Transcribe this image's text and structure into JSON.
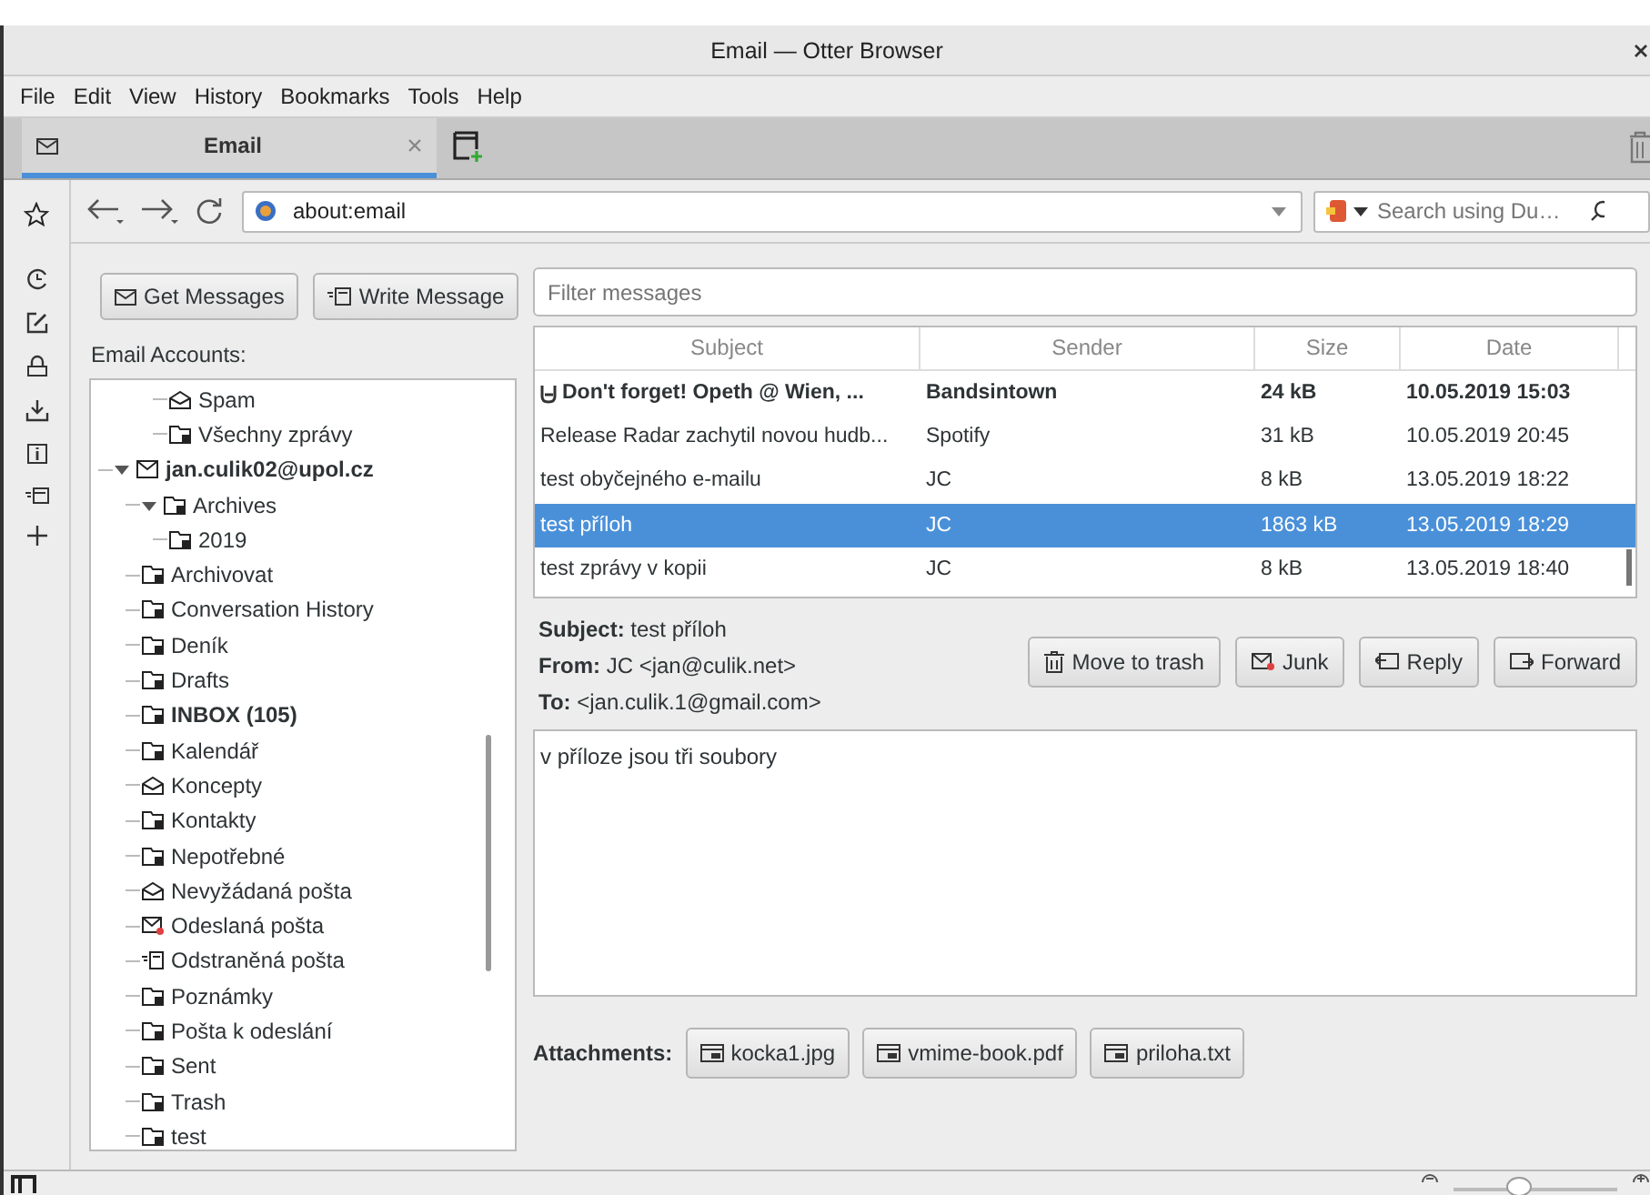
{
  "window": {
    "title": "Email — Otter Browser"
  },
  "menu": [
    "File",
    "Edit",
    "View",
    "History",
    "Bookmarks",
    "Tools",
    "Help"
  ],
  "tabs": [
    {
      "label": "Email",
      "selected": true
    }
  ],
  "address": {
    "value": "about:email"
  },
  "search": {
    "placeholder": "Search using Du…"
  },
  "toolbar": {
    "buttons": [
      "Get Messages",
      "Write Message"
    ]
  },
  "accounts_label": "Email Accounts:",
  "folders": [
    {
      "children": [
        {
          "children": [
            {
              "label": "Spam",
              "kind": "junk",
              "unread": false
            },
            {
              "label": "Všechny zprávy",
              "kind": "folder",
              "unread": false
            }
          ]
        }
      ]
    },
    {
      "label": "jan.culik02@upol.cz",
      "kind": "account",
      "unread": true,
      "expanded": true,
      "children": [
        {
          "label": "Archives",
          "kind": "folder",
          "unread": false,
          "expanded": true,
          "children": [
            {
              "label": "2019",
              "kind": "folder",
              "unread": false
            }
          ]
        },
        {
          "label": "Archivovat",
          "kind": "folder",
          "unread": false
        },
        {
          "label": "Conversation History",
          "kind": "folder",
          "unread": false
        },
        {
          "label": "Deník",
          "kind": "folder",
          "unread": false
        },
        {
          "label": "Drafts",
          "kind": "folder",
          "unread": false
        },
        {
          "label": "INBOX (105)",
          "kind": "folder",
          "unread": true
        },
        {
          "label": "Kalendář",
          "kind": "folder",
          "unread": false
        },
        {
          "label": "Koncepty",
          "kind": "junk",
          "unread": false
        },
        {
          "label": "Kontakty",
          "kind": "folder",
          "unread": false
        },
        {
          "label": "Nepotřebné",
          "kind": "folder",
          "unread": false
        },
        {
          "label": "Nevyžádaná pošta",
          "kind": "junk",
          "unread": false
        },
        {
          "label": "Odeslaná pošta",
          "kind": "sent",
          "unread": false
        },
        {
          "label": "Odstraněná pošta",
          "kind": "compose",
          "unread": false
        },
        {
          "label": "Poznámky",
          "kind": "folder",
          "unread": false
        },
        {
          "label": "Pošta k odeslání",
          "kind": "folder",
          "unread": false
        },
        {
          "label": "Sent",
          "kind": "folder",
          "unread": false
        },
        {
          "label": "Trash",
          "kind": "folder",
          "unread": false
        },
        {
          "label": "test",
          "kind": "folder",
          "unread": false
        }
      ]
    }
  ],
  "filter": {
    "placeholder": "Filter messages"
  },
  "table": {
    "columns": [
      "Subject",
      "Sender",
      "Size",
      "Date"
    ],
    "rows": [
      {
        "subject": "Don't forget! Opeth @ Wien, ...",
        "sender": "Bandsintown",
        "size": "24 kB",
        "date": "10.05.2019 15:03",
        "unread": true,
        "selected": false,
        "hand_icon": true
      },
      {
        "subject": "Release Radar zachytil novou hudb...",
        "sender": "Spotify",
        "size": "31 kB",
        "date": "10.05.2019 20:45",
        "unread": false,
        "selected": false,
        "hand_icon": false
      },
      {
        "subject": "test obyčejného e-mailu",
        "sender": "JC",
        "size": "8 kB",
        "date": "13.05.2019 18:22",
        "unread": false,
        "selected": false,
        "hand_icon": false
      },
      {
        "subject": "test příloh",
        "sender": "JC",
        "size": "1863 kB",
        "date": "13.05.2019 18:29",
        "unread": false,
        "selected": true,
        "hand_icon": false
      },
      {
        "subject": "test zprávy v kopii",
        "sender": "JC",
        "size": "8 kB",
        "date": "13.05.2019 18:40",
        "unread": false,
        "selected": false,
        "hand_icon": false
      }
    ]
  },
  "message": {
    "headers": [
      "**Subject:** test příloh",
      "**From:** JC <jan@culik.net>",
      "**To:** <jan.culik.1@gmail.com>"
    ],
    "actions": [
      {
        "label": "Move to trash",
        "kind": "trash"
      },
      {
        "label": "Junk",
        "kind": "junk"
      },
      {
        "label": "Reply",
        "kind": "reply"
      },
      {
        "label": "Forward",
        "kind": "forward"
      }
    ],
    "body": "v příloze jsou tři soubory",
    "attachments_label": "Attachments:",
    "attachments": [
      "kocka1.jpg",
      "vmime-book.pdf",
      "priloha.txt"
    ]
  },
  "zoom": {
    "level": 0.4
  }
}
